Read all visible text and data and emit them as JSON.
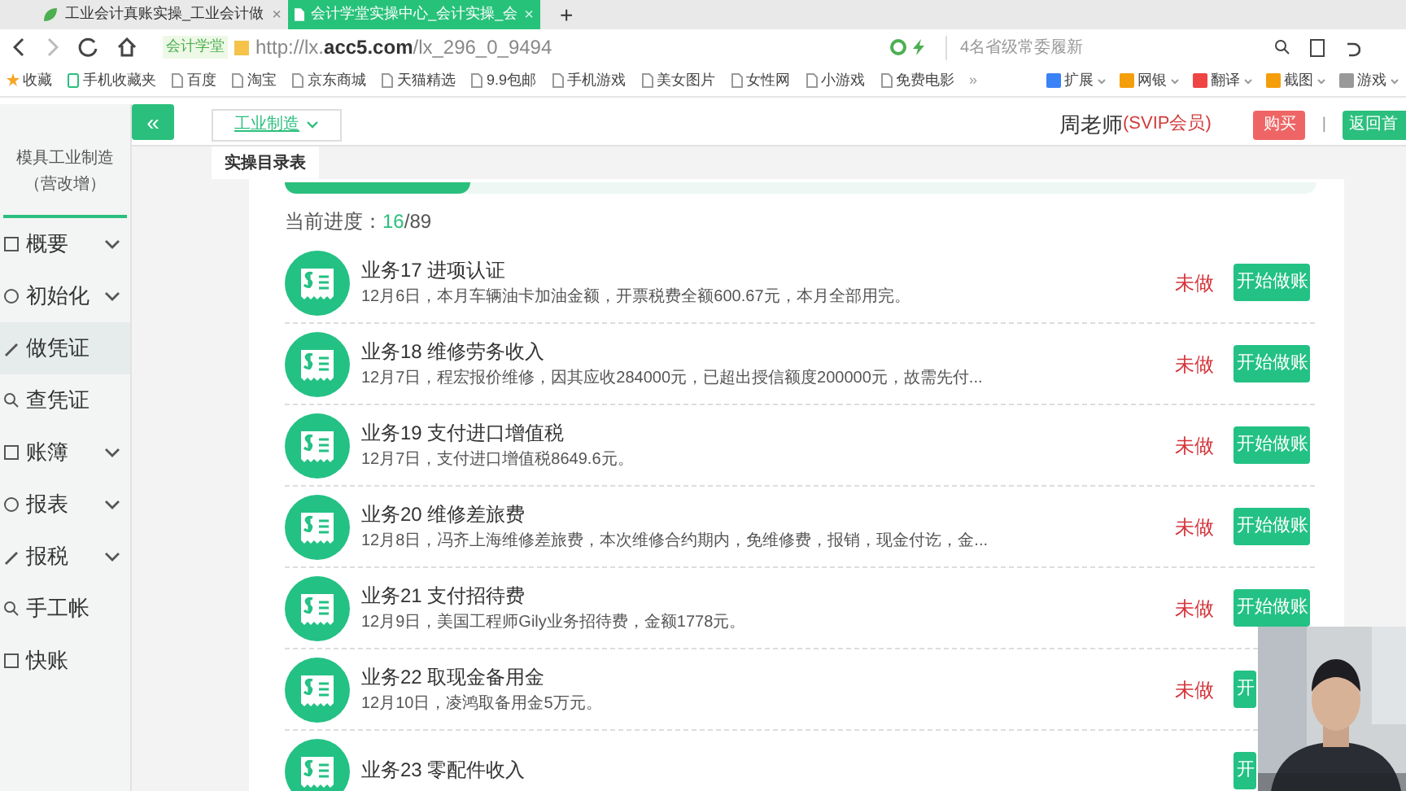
{
  "browser": {
    "tabs": [
      {
        "title": "工业会计真账实操_工业会计做",
        "selected": false
      },
      {
        "title": "会计学堂实操中心_会计实操_会",
        "selected": true
      }
    ],
    "tab_close": "×",
    "new_tab": "+",
    "address": {
      "badge": "会计学堂",
      "url": "http://lx.**acc5.com**/lx_296_0_9494"
    },
    "search": {
      "placeholder": "4名省级常委履新"
    },
    "bookmarks": [
      {
        "label": "收藏",
        "kind": "star"
      },
      {
        "label": "手机收藏夹",
        "kind": "phone"
      },
      {
        "label": "百度",
        "kind": "page"
      },
      {
        "label": "淘宝",
        "kind": "page"
      },
      {
        "label": "京东商城",
        "kind": "page"
      },
      {
        "label": "天猫精选",
        "kind": "page"
      },
      {
        "label": "9.9包邮",
        "kind": "page"
      },
      {
        "label": "手机游戏",
        "kind": "page"
      },
      {
        "label": "美女图片",
        "kind": "page"
      },
      {
        "label": "女性网",
        "kind": "page"
      },
      {
        "label": "小游戏",
        "kind": "page"
      },
      {
        "label": "免费电影",
        "kind": "page"
      }
    ],
    "more": "»",
    "tools": [
      {
        "label": "扩展"
      },
      {
        "label": "网银"
      },
      {
        "label": "翻译"
      },
      {
        "label": "截图"
      },
      {
        "label": "游戏"
      }
    ]
  },
  "sidebar": {
    "company": [
      "模具工业制造",
      "（营改增）"
    ],
    "items": [
      {
        "label": "概要",
        "expandable": true,
        "selected": false
      },
      {
        "label": "初始化",
        "expandable": true,
        "selected": false
      },
      {
        "label": "做凭证",
        "expandable": false,
        "selected": true
      },
      {
        "label": "查凭证",
        "expandable": false,
        "selected": false
      },
      {
        "label": "账簿",
        "expandable": true,
        "selected": false
      },
      {
        "label": "报表",
        "expandable": true,
        "selected": false
      },
      {
        "label": "报税",
        "expandable": true,
        "selected": false
      },
      {
        "label": "手工帐",
        "expandable": false,
        "selected": false
      },
      {
        "label": "快账",
        "expandable": false,
        "selected": false
      }
    ]
  },
  "header": {
    "collapse": "«",
    "industry": "工业制造",
    "user": "周老师",
    "role": "(SVIP会员)",
    "buy": "购买",
    "separator": "|",
    "home": "返回首"
  },
  "subtabs": [
    {
      "label": "实操目录表",
      "selected": true
    }
  ],
  "progress": {
    "level": 0.18,
    "label": "当前进度：",
    "done": "16",
    "total": "/89"
  },
  "tasks": [
    {
      "title": "业务17 进项认证",
      "desc": "12月6日，本月车辆油卡加油金额，开票税费全额600.67元，本月全部用完。",
      "status": "未做",
      "button": "开始做账"
    },
    {
      "title": "业务18 维修劳务收入",
      "desc": "12月7日，程宏报价维修，因其应收284000元，已超出授信额度200000元，故需先付...",
      "status": "未做",
      "button": "开始做账"
    },
    {
      "title": "业务19 支付进口增值税",
      "desc": "12月7日，支付进口增值税8649.6元。",
      "status": "未做",
      "button": "开始做账"
    },
    {
      "title": "业务20 维修差旅费",
      "desc": "12月8日，冯齐上海维修差旅费，本次维修合约期内，免维修费，报销，现金付讫，金...",
      "status": "未做",
      "button": "开始做账"
    },
    {
      "title": "业务21 支付招待费",
      "desc": "12月9日，美国工程师Gily业务招待费，金额1778元。",
      "status": "未做",
      "button": "开始做账"
    },
    {
      "title": "业务22 取现金备用金",
      "desc": "12月10日，凌鸿取备用金5万元。",
      "status": "未做",
      "button": "开"
    },
    {
      "title": "业务23 零配件收入",
      "button": "开"
    }
  ]
}
